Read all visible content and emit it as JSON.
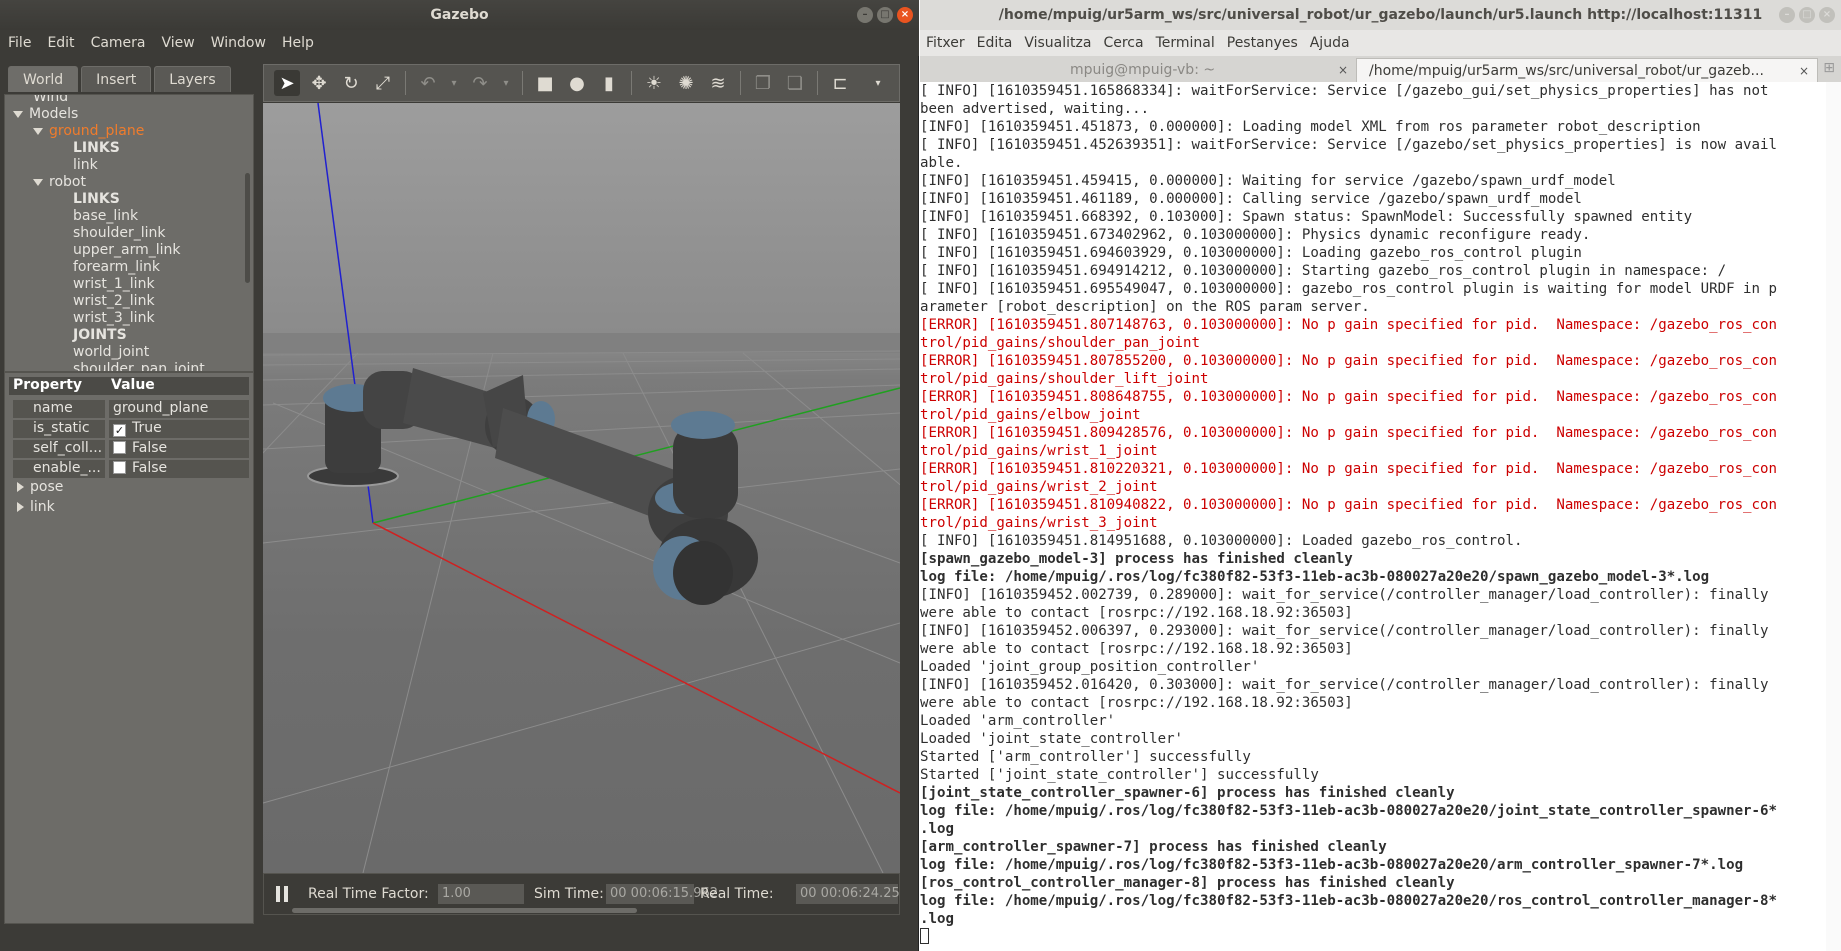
{
  "gazebo": {
    "title": "Gazebo",
    "menu": [
      "File",
      "Edit",
      "Camera",
      "View",
      "Window",
      "Help"
    ],
    "tabs": [
      "World",
      "Insert",
      "Layers"
    ],
    "tree": {
      "wind_partial": "Wind",
      "models": "Models",
      "ground_plane": "ground_plane",
      "gp_links": "LINKS",
      "gp_link": "link",
      "robot": "robot",
      "robot_links": "LINKS",
      "links": [
        "base_link",
        "shoulder_link",
        "upper_arm_link",
        "forearm_link",
        "wrist_1_link",
        "wrist_2_link",
        "wrist_3_link"
      ],
      "joints": "JOINTS",
      "joint_items": [
        "world_joint",
        "shoulder_pan_joint"
      ]
    },
    "properties": {
      "header_property": "Property",
      "header_value": "Value",
      "rows": [
        {
          "key": "name",
          "value": "ground_plane",
          "checked": null
        },
        {
          "key": "is_static",
          "value": "True",
          "checked": true
        },
        {
          "key": "self_coll...",
          "value": "False",
          "checked": false
        },
        {
          "key": "enable_...",
          "value": "False",
          "checked": false
        }
      ],
      "expandables": [
        "pose",
        "link"
      ]
    },
    "toolbar_icons": [
      "select-arrow",
      "translate",
      "rotate",
      "scale",
      "undo",
      "undo-dropdown",
      "redo",
      "redo-dropdown",
      "box",
      "sphere",
      "cylinder",
      "point-light",
      "spot-light",
      "directional-light",
      "copy",
      "paste",
      "align",
      "more"
    ],
    "bottom": {
      "rtf_label": "Real Time Factor:",
      "rtf_value": "1.00",
      "sim_label": "Sim Time:",
      "sim_value": "00 00:06:15.962",
      "real_label": "Real Time:",
      "real_value": "00 00:06:24.25"
    }
  },
  "terminal": {
    "title": "/home/mpuig/ur5arm_ws/src/universal_robot/ur_gazebo/launch/ur5.launch http://localhost:11311",
    "menu": [
      "Fitxer",
      "Edita",
      "Visualitza",
      "Cerca",
      "Terminal",
      "Pestanyes",
      "Ajuda"
    ],
    "tabs": [
      {
        "label": "mpuig@mpuig-vb: ~",
        "active": false
      },
      {
        "label": "/home/mpuig/ur5arm_ws/src/universal_robot/ur_gazeb...",
        "active": true
      }
    ],
    "lines": [
      {
        "text": "[ INFO] [1610359451.165868334]: waitForService: Service [/gazebo_gui/set_physics_properties] has not",
        "style": "normal"
      },
      {
        "text": "been advertised, waiting...",
        "style": "normal"
      },
      {
        "text": "[INFO] [1610359451.451873, 0.000000]: Loading model XML from ros parameter robot_description",
        "style": "normal"
      },
      {
        "text": "[ INFO] [1610359451.452639351]: waitForService: Service [/gazebo/set_physics_properties] is now avail",
        "style": "normal"
      },
      {
        "text": "able.",
        "style": "normal"
      },
      {
        "text": "[INFO] [1610359451.459415, 0.000000]: Waiting for service /gazebo/spawn_urdf_model",
        "style": "normal"
      },
      {
        "text": "[INFO] [1610359451.461189, 0.000000]: Calling service /gazebo/spawn_urdf_model",
        "style": "normal"
      },
      {
        "text": "[INFO] [1610359451.668392, 0.103000]: Spawn status: SpawnModel: Successfully spawned entity",
        "style": "normal"
      },
      {
        "text": "[ INFO] [1610359451.673402962, 0.103000000]: Physics dynamic reconfigure ready.",
        "style": "normal"
      },
      {
        "text": "[ INFO] [1610359451.694603929, 0.103000000]: Loading gazebo_ros_control plugin",
        "style": "normal"
      },
      {
        "text": "[ INFO] [1610359451.694914212, 0.103000000]: Starting gazebo_ros_control plugin in namespace: /",
        "style": "normal"
      },
      {
        "text": "[ INFO] [1610359451.695549047, 0.103000000]: gazebo_ros_control plugin is waiting for model URDF in p",
        "style": "normal"
      },
      {
        "text": "arameter [robot_description] on the ROS param server.",
        "style": "normal"
      },
      {
        "text": "[ERROR] [1610359451.807148763, 0.103000000]: No p gain specified for pid.  Namespace: /gazebo_ros_con",
        "style": "err"
      },
      {
        "text": "trol/pid_gains/shoulder_pan_joint",
        "style": "err"
      },
      {
        "text": "[ERROR] [1610359451.807855200, 0.103000000]: No p gain specified for pid.  Namespace: /gazebo_ros_con",
        "style": "err"
      },
      {
        "text": "trol/pid_gains/shoulder_lift_joint",
        "style": "err"
      },
      {
        "text": "[ERROR] [1610359451.808648755, 0.103000000]: No p gain specified for pid.  Namespace: /gazebo_ros_con",
        "style": "err"
      },
      {
        "text": "trol/pid_gains/elbow_joint",
        "style": "err"
      },
      {
        "text": "[ERROR] [1610359451.809428576, 0.103000000]: No p gain specified for pid.  Namespace: /gazebo_ros_con",
        "style": "err"
      },
      {
        "text": "trol/pid_gains/wrist_1_joint",
        "style": "err"
      },
      {
        "text": "[ERROR] [1610359451.810220321, 0.103000000]: No p gain specified for pid.  Namespace: /gazebo_ros_con",
        "style": "err"
      },
      {
        "text": "trol/pid_gains/wrist_2_joint",
        "style": "err"
      },
      {
        "text": "[ERROR] [1610359451.810940822, 0.103000000]: No p gain specified for pid.  Namespace: /gazebo_ros_con",
        "style": "err"
      },
      {
        "text": "trol/pid_gains/wrist_3_joint",
        "style": "err"
      },
      {
        "text": "[ INFO] [1610359451.814951688, 0.103000000]: Loaded gazebo_ros_control.",
        "style": "normal"
      },
      {
        "text": "[spawn_gazebo_model-3] process has finished cleanly",
        "style": "bold"
      },
      {
        "text": "log file: /home/mpuig/.ros/log/fc380f82-53f3-11eb-ac3b-080027a20e20/spawn_gazebo_model-3*.log",
        "style": "bold"
      },
      {
        "text": "[INFO] [1610359452.002739, 0.289000]: wait_for_service(/controller_manager/load_controller): finally",
        "style": "normal"
      },
      {
        "text": "were able to contact [rosrpc://192.168.18.92:36503]",
        "style": "normal"
      },
      {
        "text": "[INFO] [1610359452.006397, 0.293000]: wait_for_service(/controller_manager/load_controller): finally",
        "style": "normal"
      },
      {
        "text": "were able to contact [rosrpc://192.168.18.92:36503]",
        "style": "normal"
      },
      {
        "text": "Loaded 'joint_group_position_controller'",
        "style": "normal"
      },
      {
        "text": "[INFO] [1610359452.016420, 0.303000]: wait_for_service(/controller_manager/load_controller): finally",
        "style": "normal"
      },
      {
        "text": "were able to contact [rosrpc://192.168.18.92:36503]",
        "style": "normal"
      },
      {
        "text": "Loaded 'arm_controller'",
        "style": "normal"
      },
      {
        "text": "Loaded 'joint_state_controller'",
        "style": "normal"
      },
      {
        "text": "Started ['arm_controller'] successfully",
        "style": "normal"
      },
      {
        "text": "Started ['joint_state_controller'] successfully",
        "style": "normal"
      },
      {
        "text": "[joint_state_controller_spawner-6] process has finished cleanly",
        "style": "bold"
      },
      {
        "text": "log file: /home/mpuig/.ros/log/fc380f82-53f3-11eb-ac3b-080027a20e20/joint_state_controller_spawner-6*",
        "style": "bold"
      },
      {
        "text": ".log",
        "style": "bold"
      },
      {
        "text": "[arm_controller_spawner-7] process has finished cleanly",
        "style": "bold"
      },
      {
        "text": "log file: /home/mpuig/.ros/log/fc380f82-53f3-11eb-ac3b-080027a20e20/arm_controller_spawner-7*.log",
        "style": "bold"
      },
      {
        "text": "[ros_control_controller_manager-8] process has finished cleanly",
        "style": "bold"
      },
      {
        "text": "log file: /home/mpuig/.ros/log/fc380f82-53f3-11eb-ac3b-080027a20e20/ros_control_controller_manager-8*",
        "style": "bold"
      },
      {
        "text": ".log",
        "style": "bold"
      }
    ]
  },
  "colors": {
    "ubuntu_orange": "#e95420",
    "tree_selected": "#f07c2c",
    "error_red": "#cc0000",
    "axis_x": "#d02020",
    "axis_y": "#20a020",
    "axis_z": "#2020d0"
  }
}
